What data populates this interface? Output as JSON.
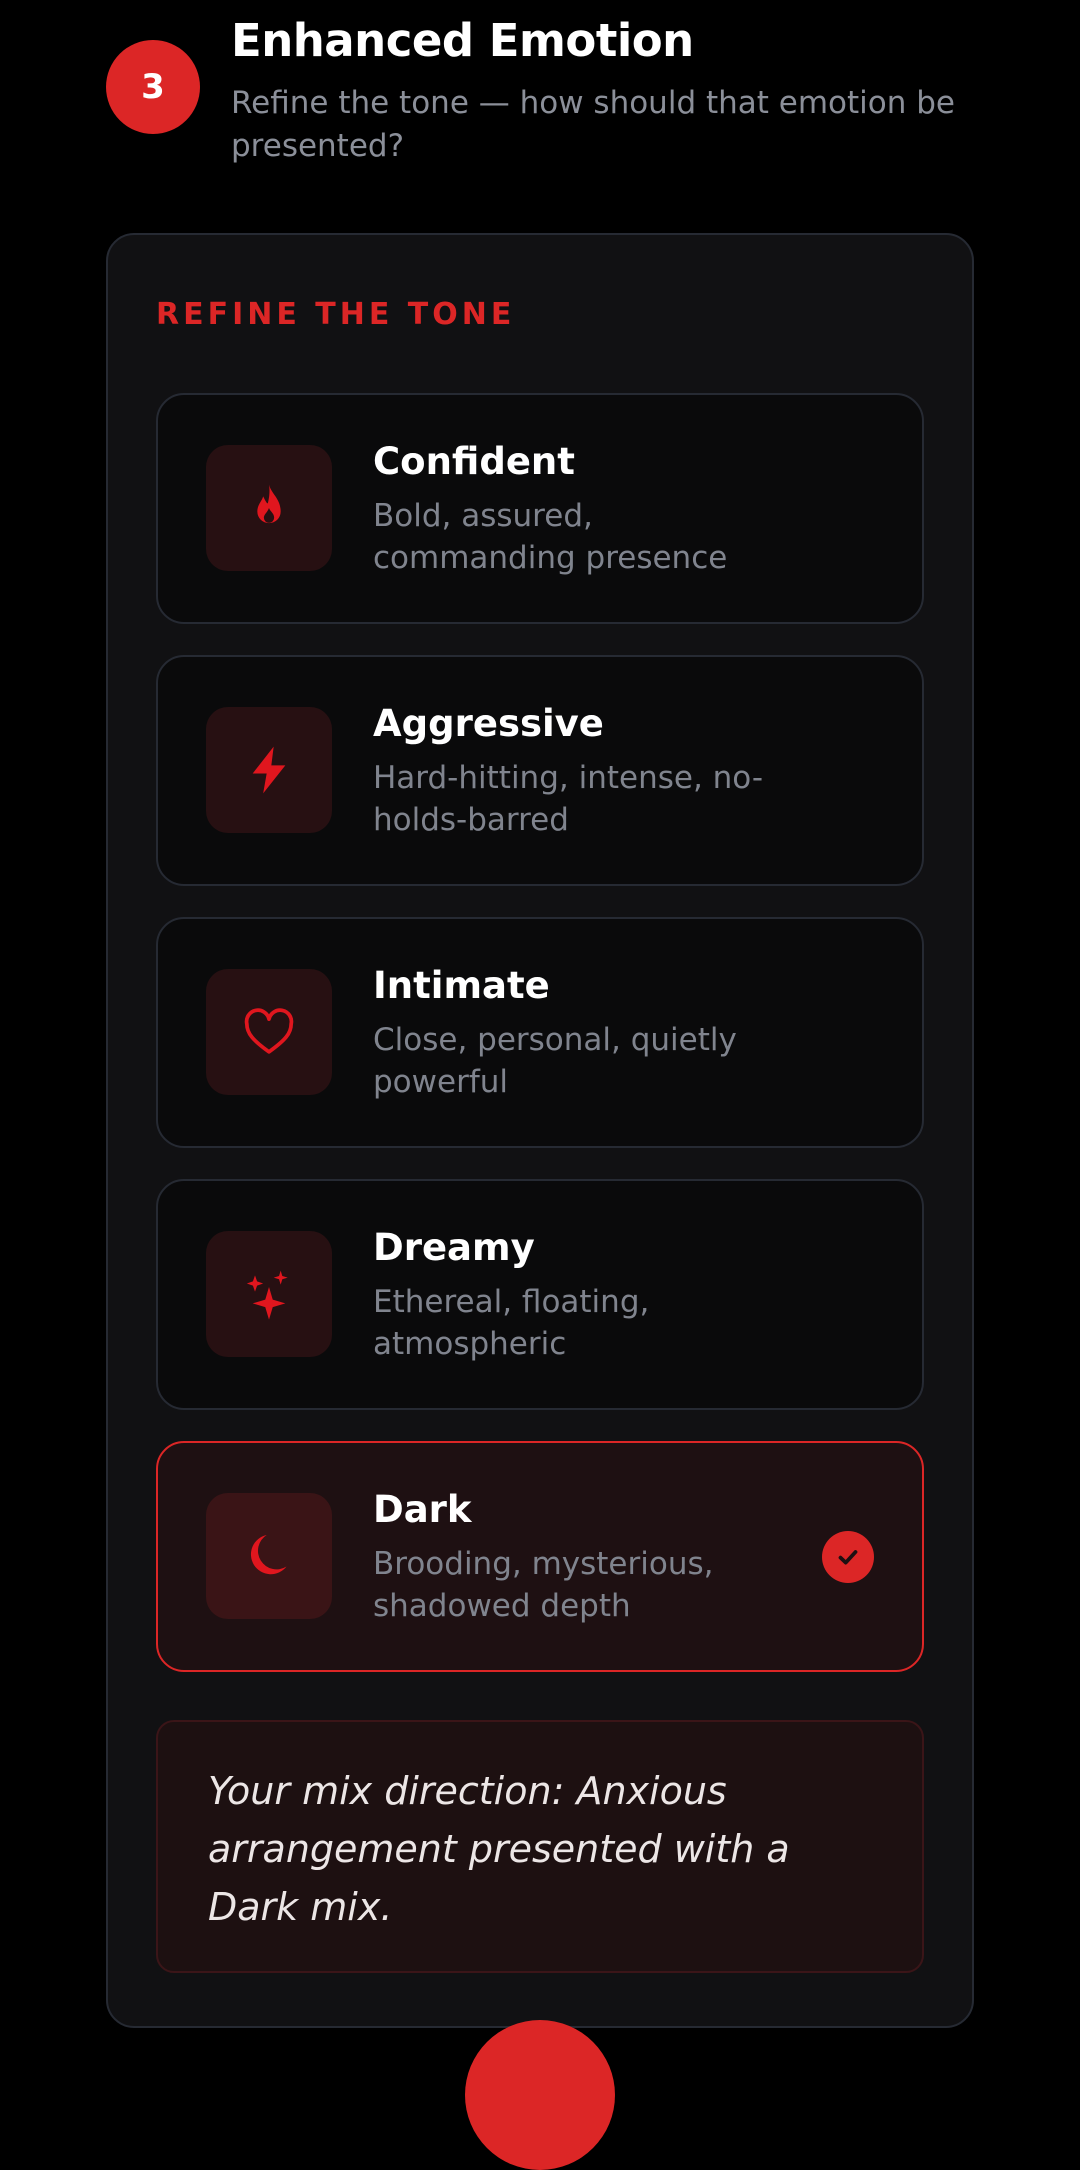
{
  "step": {
    "number": "3",
    "title": "Enhanced Emotion",
    "subtitle": "Refine the tone — how should that emotion be presented?"
  },
  "panel": {
    "heading": "REFINE THE TONE",
    "options": [
      {
        "label": "Confident",
        "description": "Bold, assured, commanding presence",
        "icon": "flame-icon",
        "selected": false
      },
      {
        "label": "Aggressive",
        "description": "Hard-hitting, intense, no-holds-barred",
        "icon": "lightning-icon",
        "selected": false
      },
      {
        "label": "Intimate",
        "description": "Close, personal, quietly powerful",
        "icon": "heart-icon",
        "selected": false
      },
      {
        "label": "Dreamy",
        "description": "Ethereal, floating, atmospheric",
        "icon": "sparkles-icon",
        "selected": false
      },
      {
        "label": "Dark",
        "description": "Brooding, mysterious, shadowed depth",
        "icon": "moon-icon",
        "selected": true
      }
    ],
    "mix_direction": "Your mix direction: Anxious arrangement presented with a Dark mix."
  },
  "colors": {
    "accent": "#dc2626",
    "background": "#000000",
    "panel": "#111113",
    "card_border": "#262a33",
    "muted_text": "#80848e"
  }
}
